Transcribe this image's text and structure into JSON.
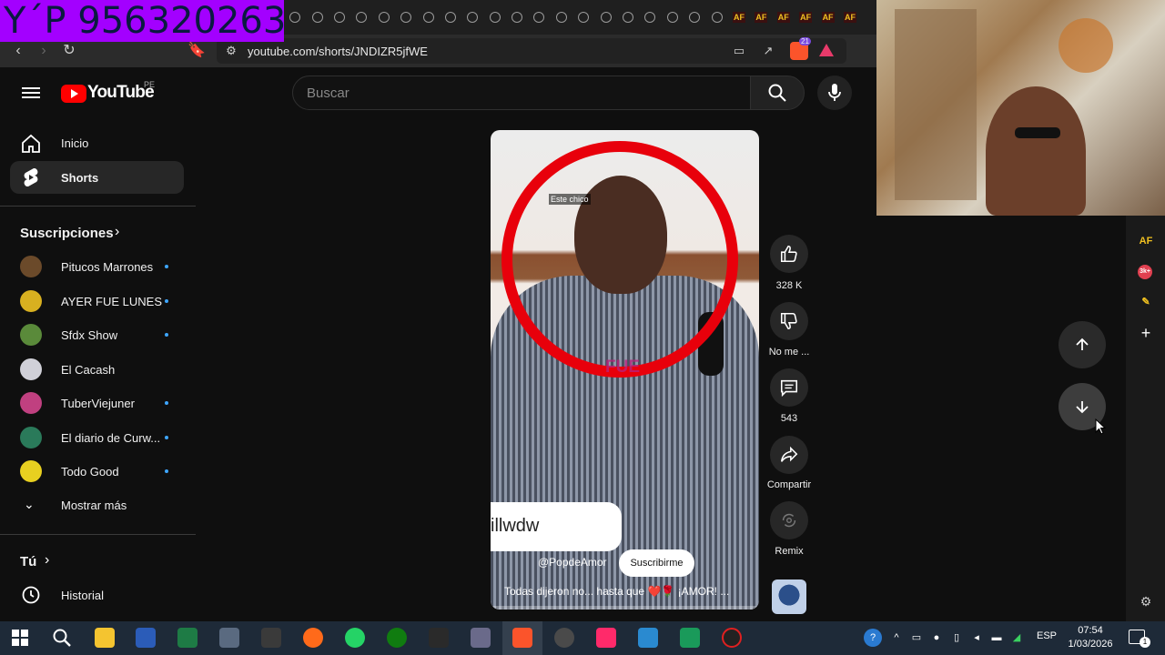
{
  "overlay": {
    "tag_text": "Y´P 956320263"
  },
  "browser": {
    "url": "youtube.com/shorts/JNDIZR5jfWE",
    "brave_badge": "21",
    "tab_icons": [
      "circle",
      "circle",
      "circle",
      "circle",
      "circle",
      "circle",
      "circle",
      "circle",
      "circle",
      "circle",
      "circle",
      "circle",
      "circle",
      "circle",
      "circle",
      "circle",
      "circle",
      "circle",
      "circle",
      "circle",
      "AF",
      "AF",
      "AF",
      "AF",
      "AF",
      "AF"
    ]
  },
  "header": {
    "logo_text": "YouTube",
    "country": "PE",
    "search_placeholder": "Buscar"
  },
  "sidebar": {
    "home": "Inicio",
    "shorts": "Shorts",
    "subscriptions_title": "Suscripciones",
    "subscriptions": [
      {
        "name": "Pitucos Marrones",
        "new": true,
        "color": "#6b4a2a"
      },
      {
        "name": "AYER FUE LUNES",
        "new": true,
        "color": "#d8b020"
      },
      {
        "name": "Sfdx Show",
        "new": true,
        "color": "#5a8a3a"
      },
      {
        "name": "El Cacash",
        "new": false,
        "color": "#d0d0d8"
      },
      {
        "name": "TuberViejuner",
        "new": true,
        "color": "#c04080"
      },
      {
        "name": "El diario de Curw...",
        "new": true,
        "color": "#2a7a5a"
      },
      {
        "name": "Todo Good",
        "new": true,
        "color": "#e8d020"
      }
    ],
    "show_more": "Mostrar más",
    "you_title": "Tú",
    "history": "Historial"
  },
  "short": {
    "ring_label": "Este chico",
    "overlay_word": "FUE",
    "watermark": "illwdw",
    "channel_handle": "@PopdeAmor",
    "subscribe": "Suscribirme",
    "title": "Todas dijeron no... hasta que ❤️🌹 ¡AMOR! ..."
  },
  "actions": {
    "likes": "328 K",
    "dislike": "No me ...",
    "comments": "543",
    "share": "Compartir",
    "remix": "Remix"
  },
  "taskbar": {
    "lang": "ESP",
    "time": "07:54",
    "date": "1/03/2026",
    "notifications": "1"
  },
  "colors": {
    "accent": "#ff0000",
    "new_dot": "#3ea6ff",
    "ring": "#e8000b",
    "tag": "#a300ff"
  }
}
